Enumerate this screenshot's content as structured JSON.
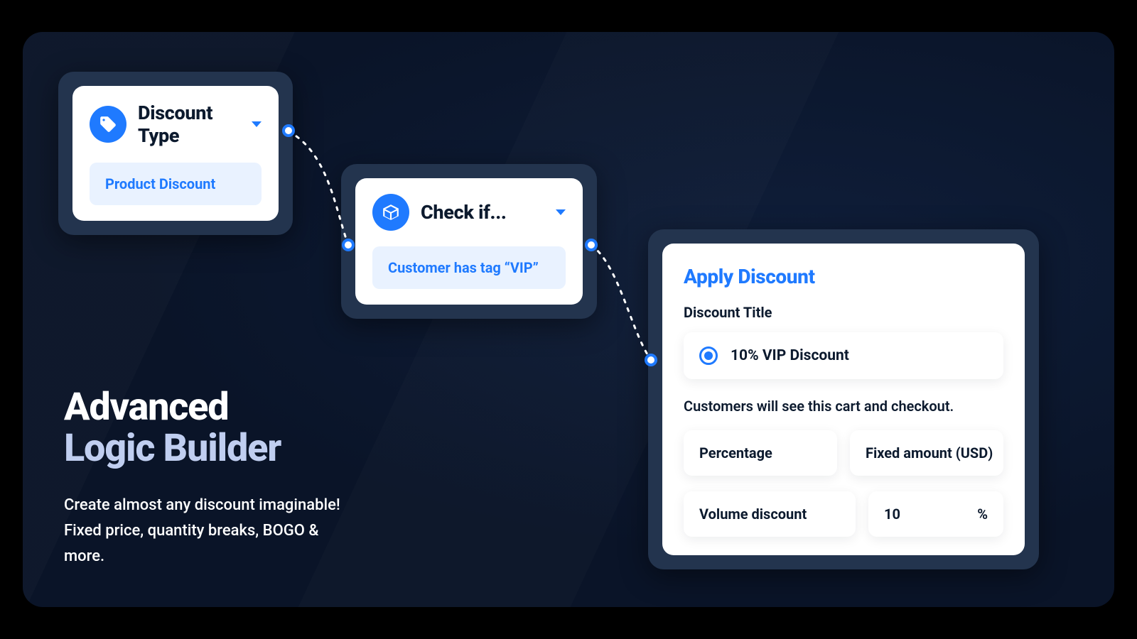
{
  "headline": {
    "line1": "Advanced",
    "line2": "Logic Builder",
    "description": "Create almost any discount imaginable! Fixed price, quantity breaks, BOGO & more."
  },
  "node_a": {
    "title": "Discount Type",
    "pill": "Product Discount"
  },
  "node_b": {
    "title": "Check if...",
    "pill": "Customer has tag “VIP”"
  },
  "node_c": {
    "title": "Apply Discount",
    "title_field_label": "Discount Title",
    "title_value": "10% VIP Discount",
    "helper": "Customers will see this cart and checkout.",
    "btn_percentage": "Percentage",
    "btn_fixed": "Fixed amount (USD)",
    "btn_volume": "Volume discount",
    "value": "10",
    "suffix": "%"
  }
}
